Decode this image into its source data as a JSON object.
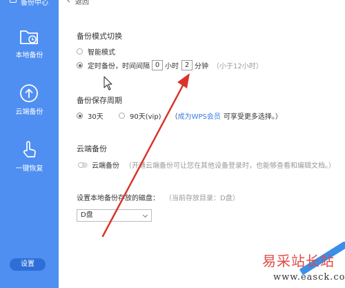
{
  "sidebar": {
    "top_label": "备份中心",
    "items": [
      {
        "label": "本地备份",
        "icon": "folder-clock-icon"
      },
      {
        "label": "云端备份",
        "icon": "cloud-upload-icon"
      },
      {
        "label": "一键恢复",
        "icon": "hand-pointer-icon"
      }
    ],
    "settings_label": "设置"
  },
  "header": {
    "back_label": "返回"
  },
  "backup_mode": {
    "title": "备份模式切换",
    "smart_label": "智能模式",
    "timed_prefix": "定时备份，时间间隔",
    "hours_value": "0",
    "hours_unit": "小时",
    "minutes_value": "2",
    "minutes_unit": "分钟",
    "hint": "（小于12小时）",
    "selected": "timed"
  },
  "retention": {
    "title": "备份保存周期",
    "option_30": "30天",
    "option_90": "90天(vip)",
    "note_open": "（",
    "vip_link": "成为WPS会员",
    "note_rest": "可享受更多选择。）",
    "selected": "30"
  },
  "cloud": {
    "title": "云端备份",
    "toggle_label": "云端备份",
    "toggle_on": false,
    "description": "（开通云端备份可让您在其他设备登录时，也能够查看和编辑文档。）"
  },
  "disk": {
    "label": "设置本地备份存放的磁盘：",
    "current": "（当前存放目录：D盘）",
    "selected_value": "D盘"
  },
  "watermark": {
    "cn": "易采站长站",
    "en": "www.easck.com"
  },
  "colors": {
    "sidebar": "#4f8ff2",
    "accent": "#3a7be0",
    "arrow": "#d9342b"
  }
}
